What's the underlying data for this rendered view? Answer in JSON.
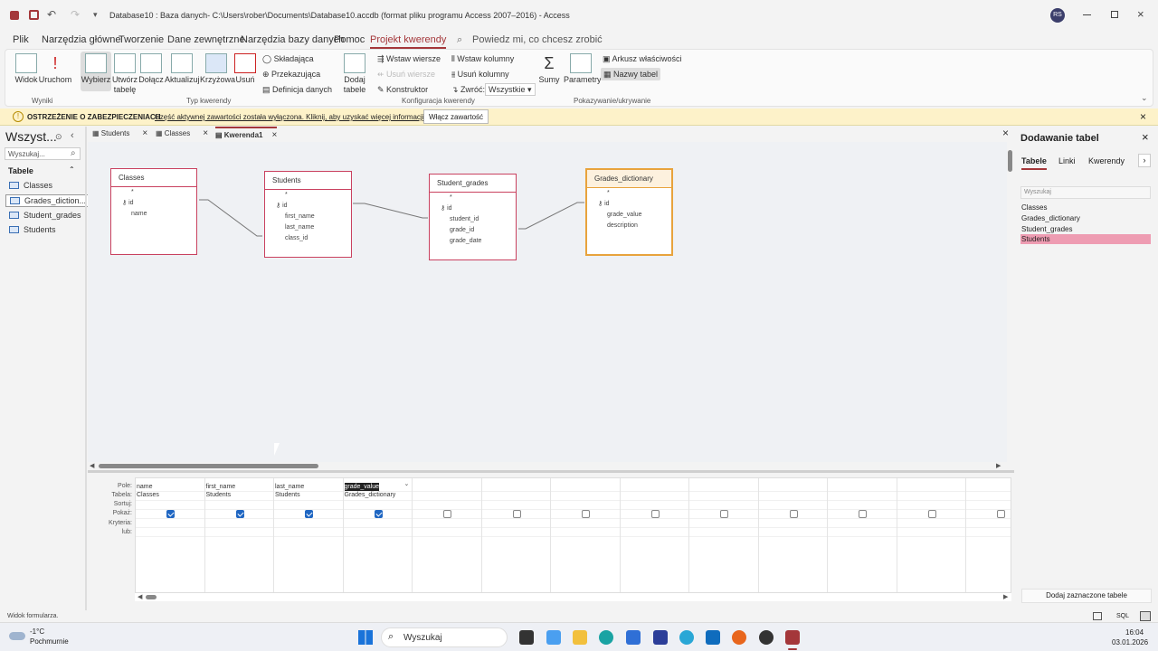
{
  "titlebar": {
    "quick_access_more": "▾",
    "title": "Database10 : Baza danych- C:\\Users\\rober\\Documents\\Database10.accdb (format pliku programu Access 2007–2016)  -  Access",
    "user_initials": "RS"
  },
  "menu": {
    "items": [
      "Plik",
      "Narzędzia główne",
      "Tworzenie",
      "Dane zewnętrzne",
      "Narzędzia bazy danych",
      "Pomoc",
      "Projekt kwerendy"
    ],
    "tell_me": "Powiedz mi, co chcesz zrobić"
  },
  "ribbon": {
    "widok": "Widok",
    "uruchom": "Uruchom",
    "wyniki_group": "Wyniki",
    "wybierz": "Wybierz",
    "utworz": "Utwórz tabelę",
    "dolacz": "Dołącz",
    "aktualizuj": "Aktualizuj",
    "krzyzowa": "Krzyżowa",
    "usun": "Usuń",
    "skladajaca": "Składająca",
    "przekazujaca": "Przekazująca",
    "definicja": "Definicja danych",
    "typ_group": "Typ kwerendy",
    "dodaj_tabele": "Dodaj tabele",
    "wstaw_wiersze": "Wstaw wiersze",
    "usun_wiersze": "Usuń wiersze",
    "konstruktor": "Konstruktor",
    "wstaw_kolumny": "Wstaw kolumny",
    "usun_kolumny": "Usuń kolumny",
    "zwroc": "Zwróć:",
    "zwroc_value": "Wszystkie",
    "konfig_group": "Konfiguracja kwerendy",
    "sumy": "Sumy",
    "parametry": "Parametry",
    "arkusz": "Arkusz właściwości",
    "nazwy_tabel": "Nazwy tabel",
    "pokaz_group": "Pokazywanie/ukrywanie"
  },
  "security": {
    "title": "OSTRZEŻENIE O ZABEZPIECZENIACH",
    "message": "Część aktywnej zawartości została wyłączona. Kliknij, aby uzyskać więcej informacji.",
    "button": "Włącz zawartość"
  },
  "nav": {
    "header": "Wszyst...",
    "search_placeholder": "Wyszukaj...",
    "group": "Tabele",
    "items": [
      "Classes",
      "Grades_diction...",
      "Student_grades",
      "Students"
    ]
  },
  "tabs": [
    "Students",
    "Classes",
    "Kwerenda1"
  ],
  "design": {
    "tables": [
      {
        "name": "Classes",
        "fields": [
          "*",
          "id",
          "name"
        ]
      },
      {
        "name": "Students",
        "fields": [
          "*",
          "id",
          "first_name",
          "last_name",
          "class_id"
        ]
      },
      {
        "name": "Student_grades",
        "fields": [
          "*",
          "id",
          "student_id",
          "grade_id",
          "grade_date"
        ]
      },
      {
        "name": "Grades_dictionary",
        "fields": [
          "*",
          "id",
          "grade_value",
          "description"
        ]
      }
    ]
  },
  "grid": {
    "row_labels": [
      "Pole:",
      "Tabela:",
      "Sortuj:",
      "Pokaż:",
      "Kryteria:",
      "lub:"
    ],
    "columns": [
      {
        "field": "name",
        "table": "Classes",
        "show": true
      },
      {
        "field": "first_name",
        "table": "Students",
        "show": true
      },
      {
        "field": "last_name",
        "table": "Students",
        "show": true
      },
      {
        "field": "grade_value",
        "table": "Grades_dictionary",
        "show": true
      },
      {
        "field": "",
        "table": "",
        "show": false
      },
      {
        "field": "",
        "table": "",
        "show": false
      },
      {
        "field": "",
        "table": "",
        "show": false
      },
      {
        "field": "",
        "table": "",
        "show": false
      },
      {
        "field": "",
        "table": "",
        "show": false
      },
      {
        "field": "",
        "table": "",
        "show": false
      },
      {
        "field": "",
        "table": "",
        "show": false
      },
      {
        "field": "",
        "table": "",
        "show": false
      },
      {
        "field": "",
        "table": "",
        "show": false
      }
    ]
  },
  "rpane": {
    "title": "Dodawanie tabel",
    "tabs": [
      "Tabele",
      "Linki",
      "Kwerendy"
    ],
    "search_placeholder": "Wyszukaj",
    "items": [
      "Classes",
      "Grades_dictionary",
      "Student_grades",
      "Students"
    ],
    "selected": "Students",
    "add_button": "Dodaj zaznaczone tabele"
  },
  "status": {
    "text": "Widok formularza.",
    "sql": "SQL"
  },
  "taskbar": {
    "temperature": "-1°C",
    "weather": "Pochmurnie",
    "search": "Wyszukaj",
    "time": "16:04",
    "date": "03.01.2026"
  }
}
